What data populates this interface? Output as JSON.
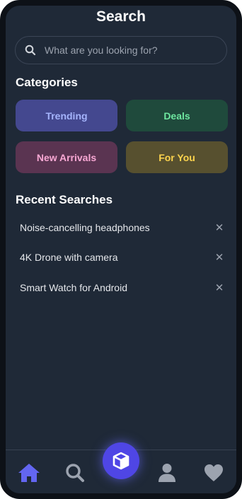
{
  "header": {
    "title": "Search"
  },
  "search": {
    "placeholder": "What are you looking for?"
  },
  "categories": {
    "title": "Categories",
    "items": [
      {
        "label": "Trending",
        "bg": "#44488f",
        "color": "#a5b4fc"
      },
      {
        "label": "Deals",
        "bg": "#1f4a3c",
        "color": "#6ee7a0"
      },
      {
        "label": "New Arrivals",
        "bg": "#5a3451",
        "color": "#f9a8d4"
      },
      {
        "label": "For You",
        "bg": "#57502f",
        "color": "#fcd34d"
      }
    ]
  },
  "recent": {
    "title": "Recent Searches",
    "items": [
      {
        "label": "Noise-cancelling headphones"
      },
      {
        "label": "4K Drone with camera"
      },
      {
        "label": "Smart Watch for Android"
      }
    ],
    "remove_glyph": "✕"
  },
  "nav": {
    "items": [
      "home-icon",
      "search-icon",
      "box-icon",
      "user-icon",
      "heart-icon"
    ],
    "active": "home-icon"
  },
  "colors": {
    "background": "#1f2937",
    "accent": "#4f46e5",
    "active_icon": "#6366f1",
    "inactive_icon": "#9ca3af"
  }
}
